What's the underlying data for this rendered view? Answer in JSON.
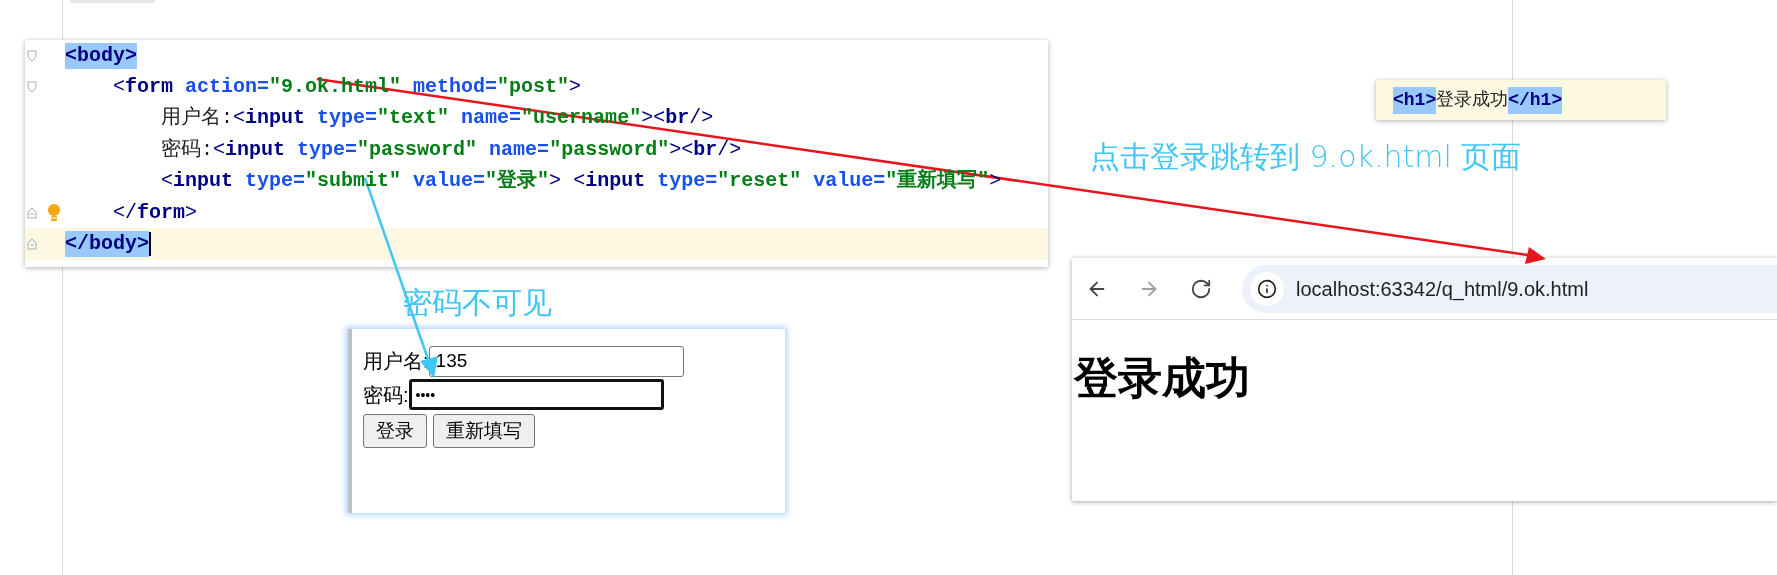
{
  "code_editor": {
    "lines": [
      {
        "kind": "fold_open",
        "bulb": false,
        "current": false,
        "segments": [
          {
            "kind": "match",
            "text": "<body>"
          }
        ]
      },
      {
        "kind": "fold_open",
        "bulb": false,
        "current": false,
        "segments": [
          {
            "kind": "bracket",
            "text": "    <"
          },
          {
            "kind": "tag",
            "text": "form"
          },
          {
            "kind": "attr",
            "text": " action="
          },
          {
            "kind": "value",
            "text": "\"9.ok.html\""
          },
          {
            "kind": "attr",
            "text": " method="
          },
          {
            "kind": "value",
            "text": "\"post\""
          },
          {
            "kind": "bracket",
            "text": ">"
          }
        ]
      },
      {
        "kind": "plain",
        "bulb": false,
        "current": false,
        "segments": [
          {
            "kind": "text",
            "text": "        用户名:"
          },
          {
            "kind": "bracket",
            "text": "<"
          },
          {
            "kind": "tag",
            "text": "input"
          },
          {
            "kind": "attr",
            "text": " type="
          },
          {
            "kind": "value",
            "text": "\"text\""
          },
          {
            "kind": "attr",
            "text": " name="
          },
          {
            "kind": "value",
            "text": "\"username\""
          },
          {
            "kind": "bracket",
            "text": "><"
          },
          {
            "kind": "tag",
            "text": "br"
          },
          {
            "kind": "bracket",
            "text": "/>"
          }
        ]
      },
      {
        "kind": "plain",
        "bulb": false,
        "current": false,
        "segments": [
          {
            "kind": "text",
            "text": "        密码:"
          },
          {
            "kind": "bracket",
            "text": "<"
          },
          {
            "kind": "tag",
            "text": "input"
          },
          {
            "kind": "attr",
            "text": " type="
          },
          {
            "kind": "value",
            "text": "\"password\""
          },
          {
            "kind": "attr",
            "text": " name="
          },
          {
            "kind": "value",
            "text": "\"password\""
          },
          {
            "kind": "bracket",
            "text": "><"
          },
          {
            "kind": "tag",
            "text": "br"
          },
          {
            "kind": "bracket",
            "text": "/>"
          }
        ]
      },
      {
        "kind": "plain",
        "bulb": false,
        "current": false,
        "segments": [
          {
            "kind": "bracket",
            "text": "        <"
          },
          {
            "kind": "tag",
            "text": "input"
          },
          {
            "kind": "attr",
            "text": " type="
          },
          {
            "kind": "value",
            "text": "\"submit\""
          },
          {
            "kind": "attr",
            "text": " value="
          },
          {
            "kind": "value",
            "text": "\"登录\""
          },
          {
            "kind": "bracket",
            "text": ">"
          },
          {
            "kind": "bracket",
            "text": " <"
          },
          {
            "kind": "tag",
            "text": "input"
          },
          {
            "kind": "attr",
            "text": " type="
          },
          {
            "kind": "value",
            "text": "\"reset\""
          },
          {
            "kind": "attr",
            "text": " value="
          },
          {
            "kind": "value",
            "text": "\"重新填写\""
          },
          {
            "kind": "bracket",
            "text": ">"
          }
        ]
      },
      {
        "kind": "fold_close",
        "bulb": true,
        "current": false,
        "segments": [
          {
            "kind": "bracket",
            "text": "    </"
          },
          {
            "kind": "tag",
            "text": "form"
          },
          {
            "kind": "bracket",
            "text": ">"
          }
        ]
      },
      {
        "kind": "fold_close",
        "bulb": false,
        "current": true,
        "segments": [
          {
            "kind": "match",
            "text": "</body>"
          }
        ]
      }
    ]
  },
  "snippet": {
    "segments": [
      {
        "kind": "match",
        "text": "<h1>"
      },
      {
        "kind": "text",
        "text": "登录成功"
      },
      {
        "kind": "match",
        "text": "</h1>"
      }
    ]
  },
  "annotations": [
    {
      "text": "点击登录跳转到 9.ok.html 页面"
    },
    {
      "text": "密码不可见"
    }
  ],
  "form_preview": {
    "username_label": "用户名:",
    "username_value": "135",
    "password_label": "密码:",
    "password_value": "••••",
    "buttons": [
      "登录",
      "重新填写"
    ]
  },
  "browser": {
    "nav": [
      {
        "kind": "back",
        "disabled": false
      },
      {
        "kind": "forward",
        "disabled": true
      },
      {
        "kind": "reload",
        "disabled": false
      }
    ],
    "url": "localhost:63342/q_html/9.ok.html",
    "heading": "登录成功"
  }
}
